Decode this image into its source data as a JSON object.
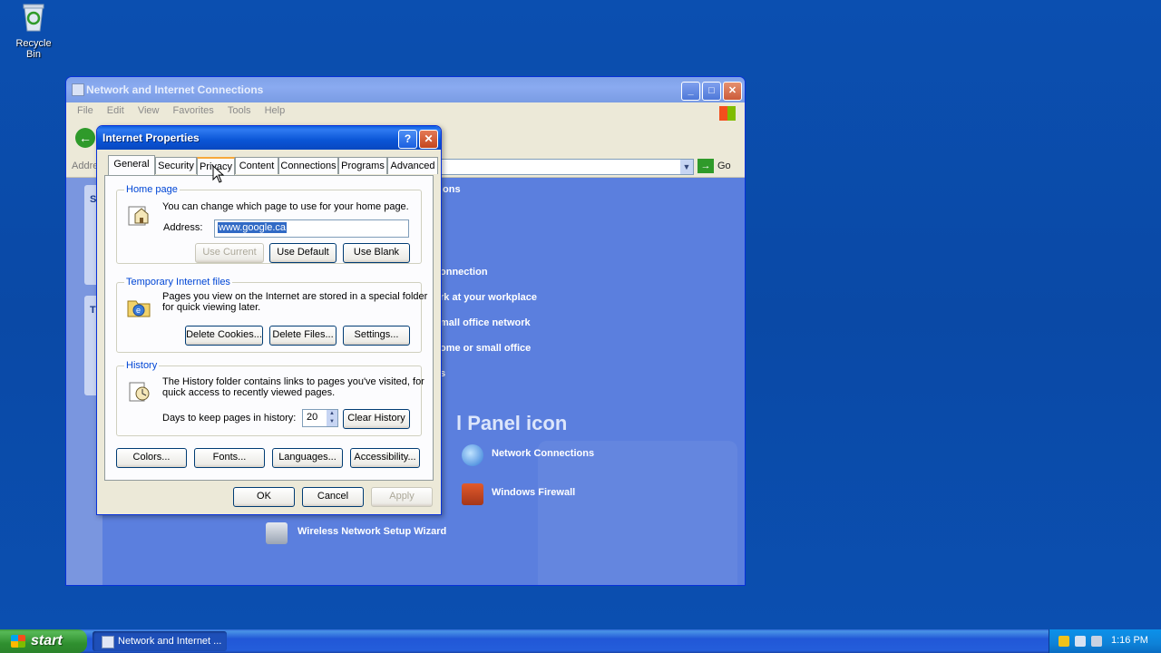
{
  "desktop": {
    "recycle_bin": "Recycle Bin"
  },
  "explorer": {
    "title": "Network and Internet Connections",
    "menu": [
      "File",
      "Edit",
      "View",
      "Favorites",
      "Tools",
      "Help"
    ],
    "address_label": "Addre",
    "go_label": "Go",
    "left_letters": [
      "S",
      "T"
    ],
    "content_fragments": {
      "frag1": "ons",
      "frag2": "onnection",
      "frag3": "rk at your workplace",
      "frag4": "mall office network",
      "frag5": "ome or small office",
      "frag6": "s"
    },
    "big_title": "l Panel icon",
    "cp_items": {
      "network_connections": "Network Connections",
      "windows_firewall": "Windows Firewall",
      "wireless_wizard": "Wireless Network Setup Wizard"
    }
  },
  "dialog": {
    "title": "Internet Properties",
    "help": "?",
    "close": "✕",
    "tabs": [
      "General",
      "Security",
      "Privacy",
      "Content",
      "Connections",
      "Programs",
      "Advanced"
    ],
    "active_tab": "General",
    "home_page": {
      "title": "Home page",
      "description": "You can change which page to use for your home page.",
      "address_label": "Address:",
      "address_value": "www.google.ca",
      "use_current": "Use Current",
      "use_default": "Use Default",
      "use_blank": "Use Blank"
    },
    "temp_files": {
      "title": "Temporary Internet files",
      "description_line1": "Pages you view on the Internet are stored in a special folder",
      "description_line2": "for quick viewing later.",
      "delete_cookies": "Delete Cookies...",
      "delete_files": "Delete Files...",
      "settings": "Settings..."
    },
    "history": {
      "title": "History",
      "description_line1": "The History folder contains links to pages you've visited, for",
      "description_line2": "quick access to recently viewed pages.",
      "days_label": "Days to keep pages in history:",
      "days_value": "20",
      "clear_history": "Clear History"
    },
    "bottom_buttons": [
      "Colors...",
      "Fonts...",
      "Languages...",
      "Accessibility..."
    ],
    "ok": "OK",
    "cancel": "Cancel",
    "apply": "Apply"
  },
  "taskbar": {
    "start": "start",
    "task_item": "Network and Internet ...",
    "clock": "1:16 PM"
  },
  "colors": {
    "desktop": "#0a4aa8",
    "dialog_title": "#0a55d6",
    "group_title": "#0046d5",
    "selection": "#316ac5"
  }
}
